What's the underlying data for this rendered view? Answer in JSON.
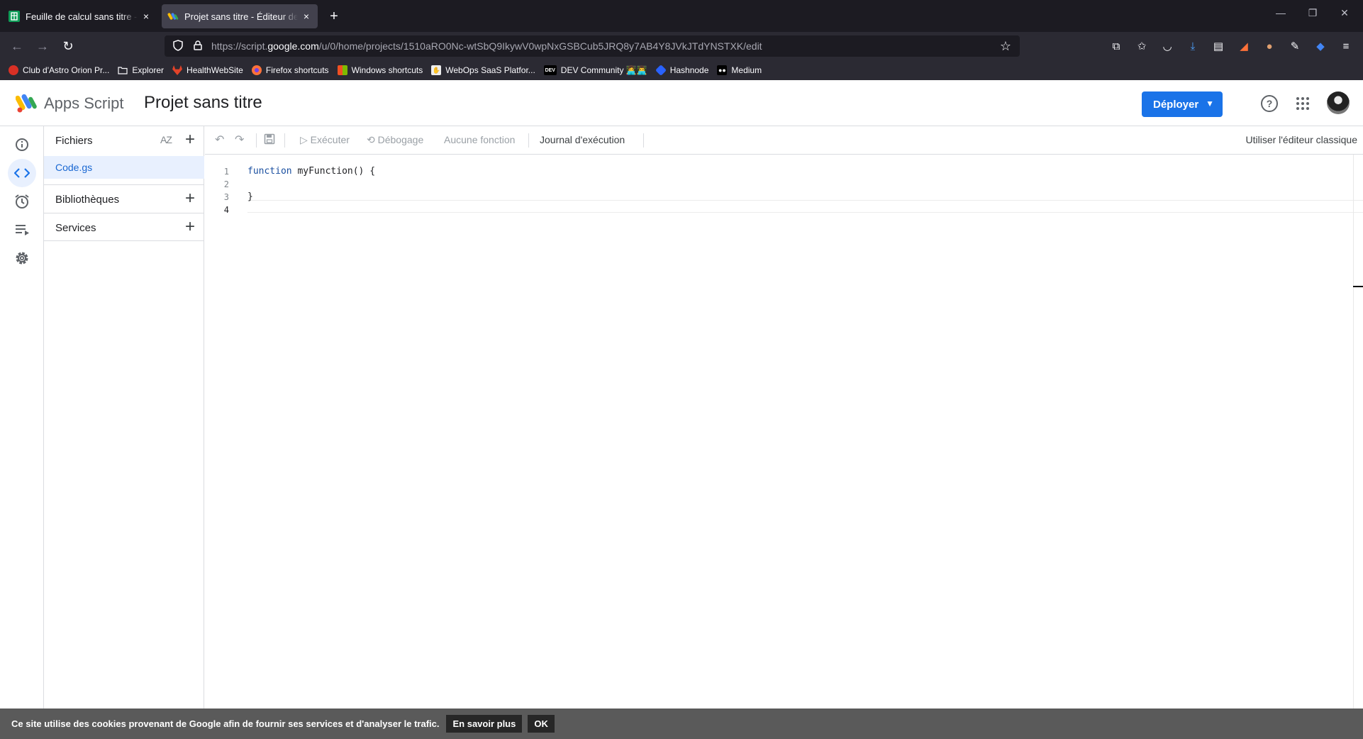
{
  "browser": {
    "tabs": [
      {
        "title": "Feuille de calcul sans titre - Google Sheets",
        "close": "×"
      },
      {
        "title": "Projet sans titre - Éditeur de projet - Apps Script",
        "close": "×"
      }
    ],
    "new_tab": "+",
    "url": {
      "prefix": "https://script.",
      "host": "google.com",
      "path": "/u/0/home/projects/1510aRO0Nc-wtSbQ9IkywV0wpNxGSBCub5JRQ8y7AB4Y8JVkJTdYNSTXK/edit"
    },
    "bookmarks": [
      {
        "label": "Club d'Astro Orion Pr...",
        "color": "#d93025",
        "icon": "astro-icon"
      },
      {
        "label": "Explorer",
        "color": "",
        "icon": "folder-icon"
      },
      {
        "label": "HealthWebSite",
        "color": "#e24329",
        "icon": "gitlab-icon"
      },
      {
        "label": "Firefox shortcuts",
        "color": "#ff7139",
        "icon": "firefox-icon"
      },
      {
        "label": "Windows shortcuts",
        "color": "#00a4ef",
        "icon": "windows-icon"
      },
      {
        "label": "WebOps SaaS Platfor...",
        "color": "#eeeeee",
        "icon": "webops-icon"
      },
      {
        "label": "DEV Community 👩‍💻👨‍💻",
        "color": "#000000",
        "icon": "dev-icon"
      },
      {
        "label": "Hashnode",
        "color": "#2962ff",
        "icon": "hashnode-icon"
      },
      {
        "label": "Medium",
        "color": "#000000",
        "icon": "medium-icon"
      }
    ]
  },
  "header": {
    "product": "Apps Script",
    "project_title": "Projet sans titre",
    "deploy_label": "Déployer"
  },
  "files_panel": {
    "title": "Fichiers",
    "sort_label": "AZ",
    "files": [
      "Code.gs"
    ],
    "libraries_label": "Bibliothèques",
    "services_label": "Services"
  },
  "toolbar": {
    "run": "Exécuter",
    "debug": "Débogage",
    "no_function": "Aucune fonction",
    "execution_log": "Journal d'exécution",
    "classic_editor": "Utiliser l'éditeur classique"
  },
  "editor": {
    "lines": [
      {
        "num": "1",
        "keyword": "function",
        "rest": " myFunction() {"
      },
      {
        "num": "2",
        "keyword": "",
        "rest": ""
      },
      {
        "num": "3",
        "keyword": "",
        "rest": "}"
      },
      {
        "num": "4",
        "keyword": "",
        "rest": ""
      }
    ]
  },
  "cookie_banner": {
    "text": "Ce site utilise des cookies provenant de Google afin de fournir ses services et d'analyser le trafic.",
    "learn_more": "En savoir plus",
    "ok": "OK"
  },
  "colors": {
    "accent": "#1a73e8",
    "active_bg": "#e8f0fe",
    "browser_bg": "#1c1b22"
  }
}
